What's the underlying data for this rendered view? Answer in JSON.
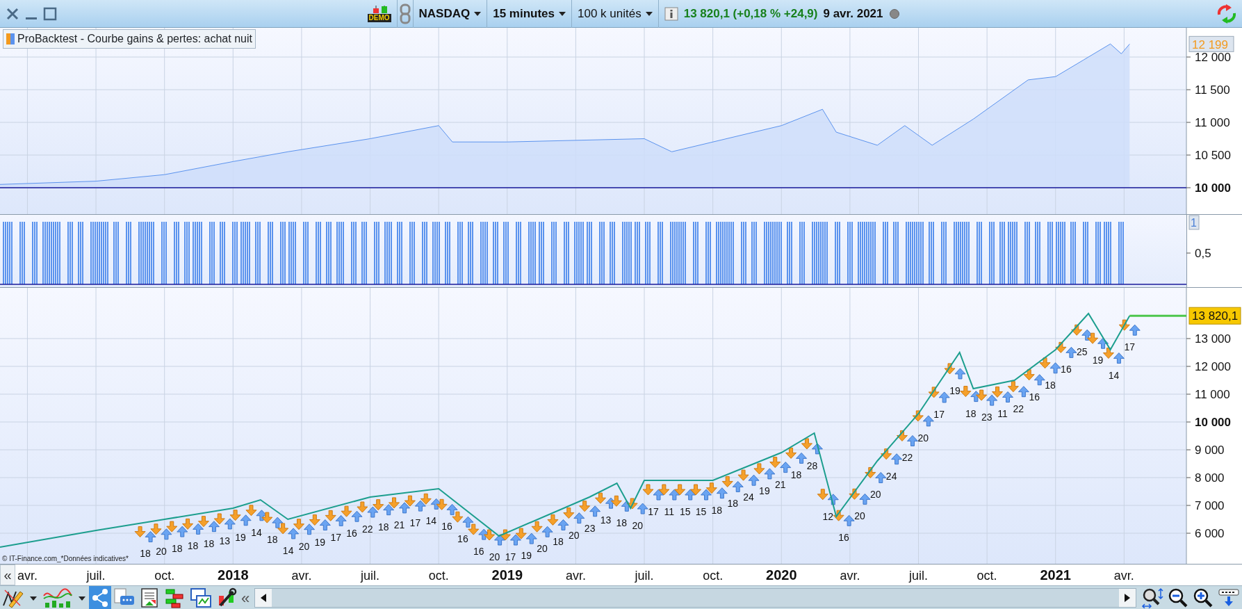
{
  "toolbar": {
    "demo_label": "DEMO",
    "instrument": "NASDAQ",
    "timeframe": "15 minutes",
    "units": "100 k unités",
    "quote": "13 820,1 (+0,18 % +24,9)",
    "date": "9 avr. 2021"
  },
  "equity_panel": {
    "legend": "ProBacktest - Courbe gains & pertes: achat nuit",
    "last_value": "12 199",
    "chart_data": {
      "type": "area",
      "grid": true,
      "xlim": [
        2017.15,
        2021.68
      ],
      "ylim": [
        9596,
        12447
      ],
      "x": [
        2017.15,
        2017.5,
        2017.75,
        2018.0,
        2018.2,
        2018.5,
        2018.75,
        2018.8,
        2019.0,
        2019.5,
        2019.6,
        2019.9,
        2020.0,
        2020.15,
        2020.2,
        2020.35,
        2020.45,
        2020.55,
        2020.7,
        2020.9,
        2021.0,
        2021.1,
        2021.2,
        2021.24,
        2021.27
      ],
      "values": [
        10050,
        10100,
        10200,
        10400,
        10550,
        10750,
        10950,
        10700,
        10700,
        10750,
        10550,
        10850,
        10950,
        11200,
        10850,
        10650,
        10950,
        10650,
        11050,
        11650,
        11700,
        11950,
        12200,
        12050,
        12199
      ],
      "ref_lines": [
        {
          "axis": "y",
          "value": 10000
        }
      ],
      "yticks": [
        {
          "value": 10000,
          "label": "10 000"
        },
        {
          "value": 10500,
          "label": "10 500"
        },
        {
          "value": 11000,
          "label": "11 000"
        },
        {
          "value": 11500,
          "label": "11 500"
        },
        {
          "value": 12000,
          "label": "12 000"
        }
      ]
    }
  },
  "position_panel": {
    "last_value": "1",
    "tick": "0,5"
  },
  "price_panel": {
    "last_price": "13 820,1",
    "credit": "© IT-Finance.com_*Données indicatives*",
    "chart_data": {
      "type": "line",
      "grid": true,
      "xlim": [
        2017.15,
        2021.68
      ],
      "ylim": [
        4900,
        14825
      ],
      "x": [
        2017.15,
        2017.5,
        2017.75,
        2018.0,
        2018.1,
        2018.2,
        2018.5,
        2018.75,
        2018.97,
        2019.3,
        2019.4,
        2019.45,
        2019.5,
        2019.75,
        2020.0,
        2020.12,
        2020.2,
        2020.35,
        2020.5,
        2020.65,
        2020.7,
        2020.85,
        2021.0,
        2021.12,
        2021.2,
        2021.27
      ],
      "values": [
        5500,
        6100,
        6500,
        6900,
        7200,
        6500,
        7300,
        7600,
        5900,
        7300,
        7800,
        6900,
        7900,
        7900,
        8900,
        9600,
        6600,
        8600,
        10300,
        12500,
        11200,
        11500,
        12600,
        13900,
        12600,
        13820
      ],
      "yticks": [
        {
          "value": 6000,
          "label": "6 000"
        },
        {
          "value": 7000,
          "label": "7 000"
        },
        {
          "value": 8000,
          "label": "8 000"
        },
        {
          "value": 9000,
          "label": "9 000"
        },
        {
          "value": 10000,
          "label": "10 000"
        },
        {
          "value": 11000,
          "label": "11 000"
        },
        {
          "value": 12000,
          "label": "12 000"
        },
        {
          "value": 13000,
          "label": "13 000"
        }
      ],
      "xticks": [
        {
          "value": 2017.25,
          "label": "avr."
        },
        {
          "value": 2017.5,
          "label": "juil."
        },
        {
          "value": 2017.75,
          "label": "oct."
        },
        {
          "value": 2018.0,
          "label": "2018"
        },
        {
          "value": 2018.25,
          "label": "avr."
        },
        {
          "value": 2018.5,
          "label": "juil."
        },
        {
          "value": 2018.75,
          "label": "oct."
        },
        {
          "value": 2019.0,
          "label": "2019"
        },
        {
          "value": 2019.25,
          "label": "avr."
        },
        {
          "value": 2019.5,
          "label": "juil."
        },
        {
          "value": 2019.75,
          "label": "oct."
        },
        {
          "value": 2020.0,
          "label": "2020"
        },
        {
          "value": 2020.25,
          "label": "avr."
        },
        {
          "value": 2020.5,
          "label": "juil."
        },
        {
          "value": 2020.75,
          "label": "oct."
        },
        {
          "value": 2021.0,
          "label": "2021"
        },
        {
          "value": 2021.25,
          "label": "avr."
        }
      ],
      "annotations": [
        "18",
        "20",
        "18",
        "18",
        "18",
        "13",
        "19",
        "14",
        "18",
        "14",
        "20",
        "19",
        "17",
        "16",
        "22",
        "18",
        "21",
        "17",
        "14",
        "16",
        "16",
        "16",
        "20",
        "17",
        "19",
        "20",
        "18",
        "20",
        "23",
        "13",
        "18",
        "20",
        "17",
        "11",
        "15",
        "15",
        "18",
        "18",
        "24",
        "19",
        "21",
        "18",
        "28",
        "12",
        "16",
        "20",
        "20",
        "24",
        "22",
        "20",
        "17",
        "19",
        "18",
        "23",
        "11",
        "22",
        "16",
        "18",
        "16",
        "25",
        "19",
        "14",
        "17"
      ]
    }
  },
  "axis_scroll_label": "«",
  "bottom_toolbar": {
    "collapse_label": "«"
  }
}
